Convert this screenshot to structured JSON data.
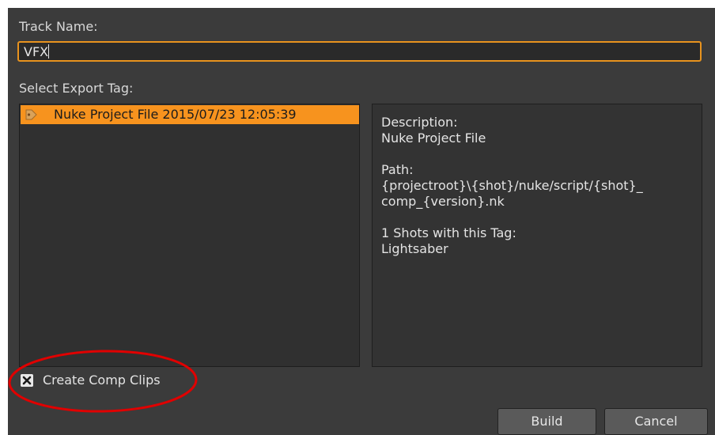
{
  "track_name": {
    "label": "Track Name:",
    "value": "VFX"
  },
  "export_tag": {
    "label": "Select Export Tag:",
    "items": [
      {
        "label": "Nuke Project File 2015/07/23 12:05:39",
        "selected": true,
        "icon": "nuke-tag-icon"
      }
    ]
  },
  "description": {
    "heading": "Description:",
    "text": "Nuke Project File",
    "path_heading": "Path:",
    "path_line1": "{projectroot}\\{shot}/nuke/script/{shot}_",
    "path_line2": "comp_{version}.nk",
    "shots_heading": "1 Shots with this Tag:",
    "shots_value": "Lightsaber"
  },
  "create_comp_clips": {
    "label": "Create Comp Clips",
    "checked": true
  },
  "buttons": {
    "build": "Build",
    "cancel": "Cancel"
  },
  "colors": {
    "dialog_bg": "#3b3b3b",
    "accent": "#f7931e",
    "annotation": "#e00000"
  }
}
